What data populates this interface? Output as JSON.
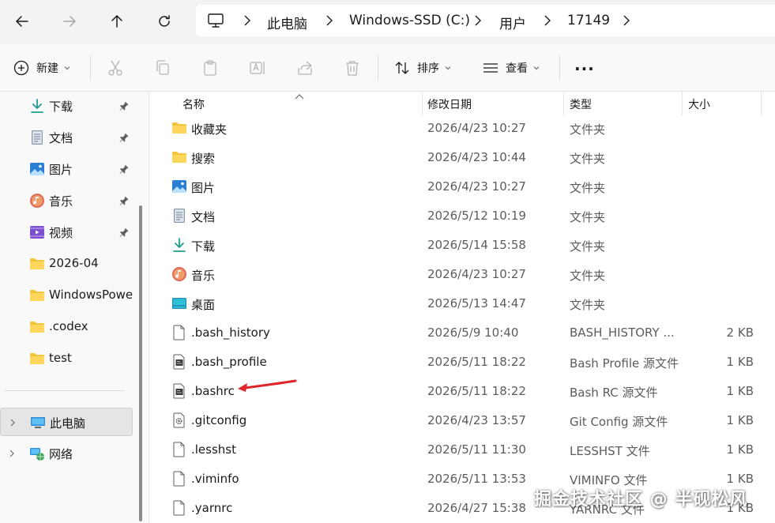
{
  "address": {
    "breadcrumbs": [
      "此电脑",
      "Windows-SSD (C:)",
      "用户",
      "17149"
    ]
  },
  "toolbar": {
    "new_label": "新建",
    "sort_label": "排序",
    "view_label": "查看",
    "more_label": "..."
  },
  "sidebar": {
    "quick_access": [
      {
        "label": "下载",
        "icon": "download-icon"
      },
      {
        "label": "文档",
        "icon": "document-icon"
      },
      {
        "label": "图片",
        "icon": "pictures-icon"
      },
      {
        "label": "音乐",
        "icon": "music-icon"
      },
      {
        "label": "视频",
        "icon": "videos-icon"
      },
      {
        "label": "2026-04",
        "icon": "folder-icon"
      },
      {
        "label": "WindowsPowe",
        "icon": "folder-icon"
      },
      {
        "label": ".codex",
        "icon": "folder-icon"
      },
      {
        "label": "test",
        "icon": "folder-icon"
      }
    ],
    "this_pc": "此电脑",
    "network": "网络"
  },
  "columns": {
    "name": "名称",
    "modified": "修改日期",
    "type": "类型",
    "size": "大小"
  },
  "files": [
    {
      "name": "收藏夹",
      "modified": "2026/4/23 10:27",
      "type": "文件夹",
      "size": "",
      "icon": "folder-icon"
    },
    {
      "name": "搜索",
      "modified": "2026/4/23 10:44",
      "type": "文件夹",
      "size": "",
      "icon": "folder-icon"
    },
    {
      "name": "图片",
      "modified": "2026/4/23 10:27",
      "type": "文件夹",
      "size": "",
      "icon": "pictures-icon"
    },
    {
      "name": "文档",
      "modified": "2026/5/12 10:19",
      "type": "文件夹",
      "size": "",
      "icon": "document-icon"
    },
    {
      "name": "下载",
      "modified": "2026/5/14 15:58",
      "type": "文件夹",
      "size": "",
      "icon": "download-icon"
    },
    {
      "name": "音乐",
      "modified": "2026/4/23 10:27",
      "type": "文件夹",
      "size": "",
      "icon": "music-icon"
    },
    {
      "name": "桌面",
      "modified": "2026/5/13 14:47",
      "type": "文件夹",
      "size": "",
      "icon": "desktop-icon"
    },
    {
      "name": ".bash_history",
      "modified": "2026/5/9 10:40",
      "type": "BASH_HISTORY ...",
      "size": "2 KB",
      "icon": "blank-file-icon"
    },
    {
      "name": ".bash_profile",
      "modified": "2026/5/11 18:22",
      "type": "Bash Profile 源文件",
      "size": "1 KB",
      "icon": "source-file-icon"
    },
    {
      "name": ".bashrc",
      "modified": "2026/5/11 18:22",
      "type": "Bash RC 源文件",
      "size": "1 KB",
      "icon": "source-file-icon"
    },
    {
      "name": ".gitconfig",
      "modified": "2026/4/23 13:57",
      "type": "Git Config 源文件",
      "size": "1 KB",
      "icon": "config-file-icon"
    },
    {
      "name": ".lesshst",
      "modified": "2026/5/11 11:30",
      "type": "LESSHST 文件",
      "size": "1 KB",
      "icon": "blank-file-icon"
    },
    {
      "name": ".viminfo",
      "modified": "2026/5/11 13:53",
      "type": "VIMINFO 文件",
      "size": "1 KB",
      "icon": "blank-file-icon"
    },
    {
      "name": ".yarnrc",
      "modified": "2026/4/27 15:38",
      "type": "YARNRC 文件",
      "size": "1 KB",
      "icon": "blank-file-icon"
    }
  ],
  "watermark": "掘金技术社区 @ 半砚松风",
  "colors": {
    "folder": "#f4c43a",
    "accent": "#1a73c7",
    "arrow": "#e0242b"
  }
}
